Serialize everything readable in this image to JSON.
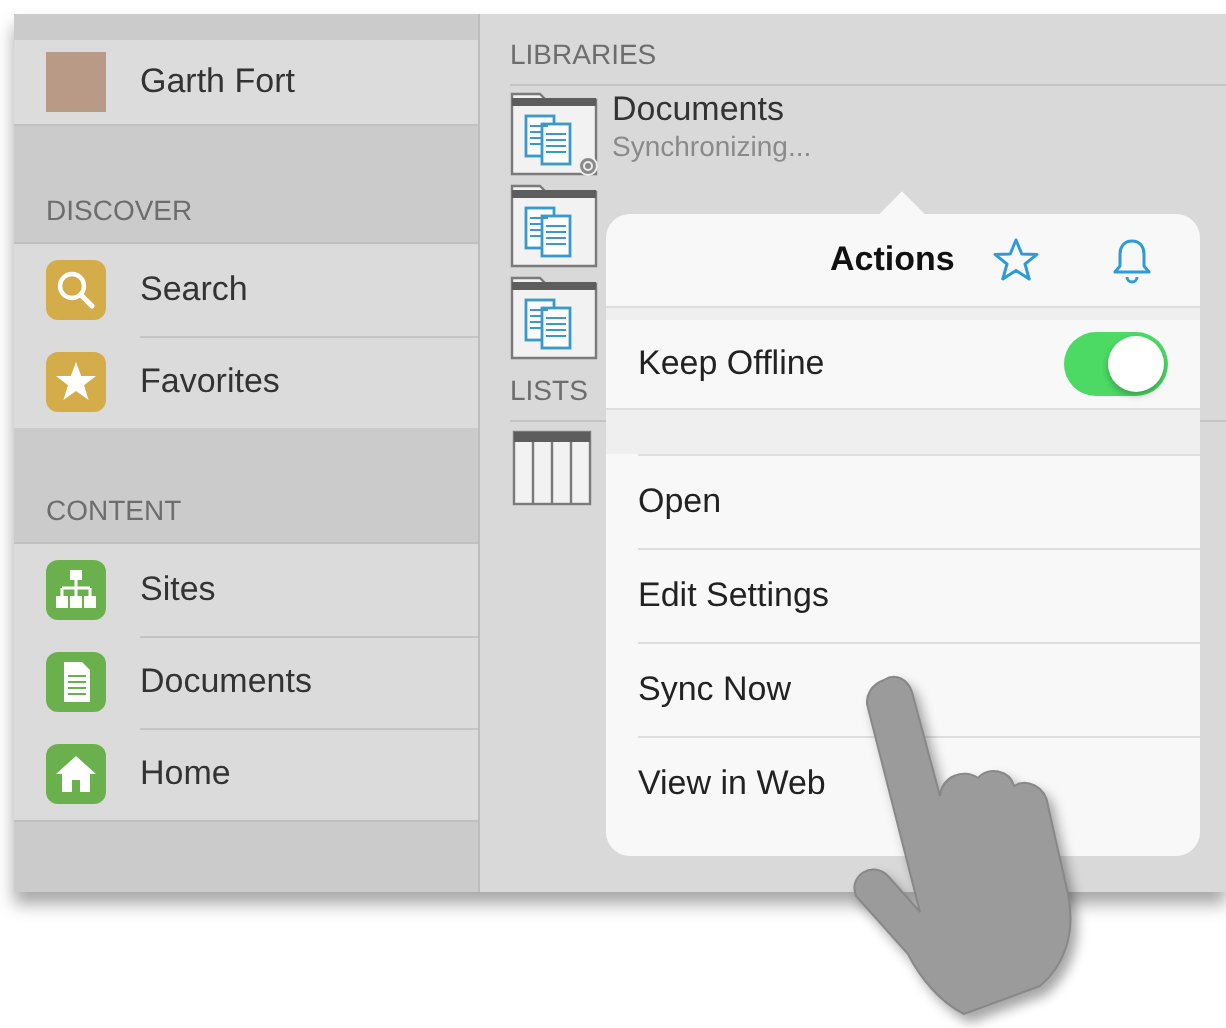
{
  "profile": {
    "name": "Garth Fort"
  },
  "sidebar": {
    "sections": [
      {
        "title": "DISCOVER",
        "items": [
          {
            "label": "Search",
            "kind": "search"
          },
          {
            "label": "Favorites",
            "kind": "star"
          }
        ]
      },
      {
        "title": "CONTENT",
        "items": [
          {
            "label": "Sites",
            "kind": "sitemap"
          },
          {
            "label": "Documents",
            "kind": "document"
          },
          {
            "label": "Home",
            "kind": "home"
          }
        ]
      }
    ]
  },
  "libraries": {
    "title": "LIBRARIES",
    "items": [
      {
        "name": "Documents",
        "status": "Synchronizing...",
        "syncing": true
      },
      {
        "syncing": false
      },
      {
        "syncing": false
      }
    ]
  },
  "lists": {
    "title": "LISTS",
    "items": [
      {
        "kind": "list"
      }
    ]
  },
  "popover": {
    "title": "Actions",
    "toggles": [
      {
        "label": "Keep Offline",
        "on": true
      }
    ],
    "actions": [
      "Open",
      "Edit Settings",
      "Sync Now",
      "View in Web"
    ]
  }
}
